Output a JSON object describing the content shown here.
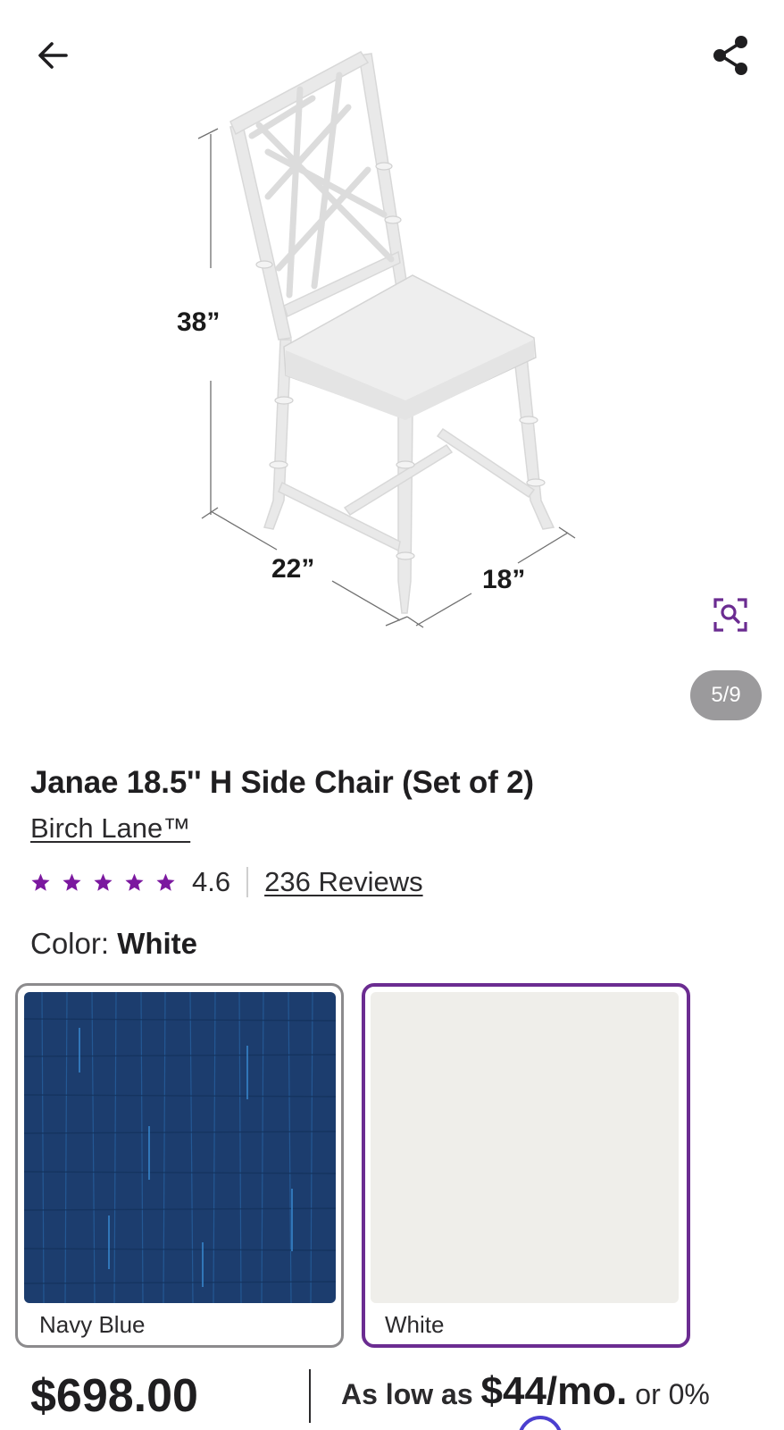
{
  "header": {
    "back_icon": "arrow-left-icon",
    "share_icon": "share-icon"
  },
  "gallery": {
    "dimensions": {
      "height": "38”",
      "width": "22”",
      "depth": "18”"
    },
    "zoom_icon": "zoom-search-icon",
    "counter": "5/9"
  },
  "product": {
    "title": "Janae 18.5'' H Side Chair (Set of 2)",
    "brand": "Birch Lane™",
    "rating": {
      "stars": 5,
      "value": "4.6",
      "reviews_label": "236 Reviews",
      "star_color": "#7b189f"
    },
    "color": {
      "label": "Color: ",
      "selected": "White"
    },
    "swatches": [
      {
        "label": "Navy Blue",
        "color": "#1c3d6e",
        "selected": false
      },
      {
        "label": "White",
        "color": "#efeeea",
        "selected": true
      }
    ],
    "price": "$698.00",
    "financing": {
      "prefix": "As low as ",
      "amount": "$44/mo.",
      "suffix": " or 0%"
    }
  },
  "colors": {
    "accent": "#6b2c91",
    "counter_bg": "#9b9a9c"
  }
}
